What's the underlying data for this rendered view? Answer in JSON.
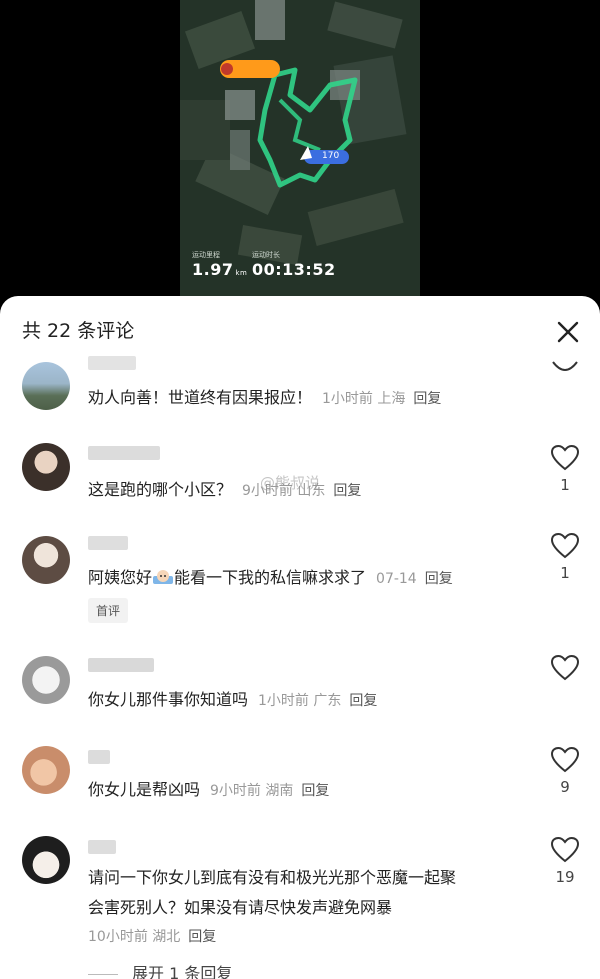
{
  "video": {
    "distance_label": "运动里程",
    "distance_value": "1.97",
    "distance_unit": "km",
    "duration_label": "运动时长",
    "duration_value": "00:13:52",
    "marker_value": "170"
  },
  "sheet": {
    "title": "共 22 条评论",
    "close_icon": "close-icon",
    "watermark": "@熊叔说"
  },
  "comments": [
    {
      "text": "劝人向善！世道终有因果报应！",
      "time": "1小时前",
      "location": "上海",
      "reply": "回复",
      "likes": ""
    },
    {
      "text": "这是跑的哪个小区？",
      "time": "9小时前",
      "location": "山东",
      "reply": "回复",
      "likes": "1"
    },
    {
      "text_before": "阿姨您好",
      "text_after": "能看一下我的私信嘛求求了",
      "time": "07-14",
      "location": "",
      "reply": "回复",
      "likes": "1",
      "badge": "首评"
    },
    {
      "text": "你女儿那件事你知道吗",
      "time": "1小时前",
      "location": "广东",
      "reply": "回复",
      "likes": ""
    },
    {
      "text": "你女儿是帮凶吗",
      "time": "9小时前",
      "location": "湖南",
      "reply": "回复",
      "likes": "9"
    },
    {
      "line1": "请问一下你女儿到底有没有和极光光那个恶魔一起聚",
      "line2": "会害死别人？如果没有请尽快发声避免网暴",
      "time": "10小时前",
      "location": "湖北",
      "reply": "回复",
      "likes": "19"
    }
  ],
  "expand_label": "展开 1 条回复"
}
